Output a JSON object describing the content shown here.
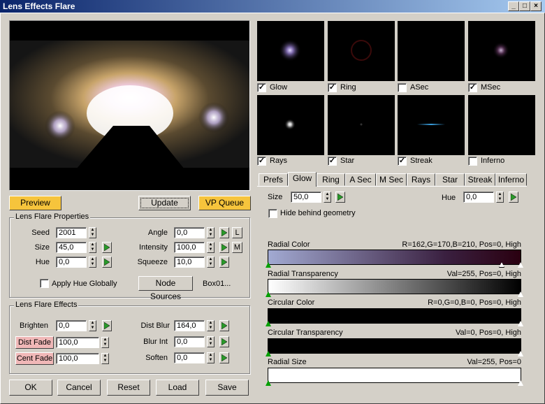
{
  "window": {
    "title": "Lens Effects Flare"
  },
  "buttons": {
    "preview": "Preview",
    "update": "Update",
    "vp_queue": "VP Queue",
    "node_sources": "Node Sources",
    "ok": "OK",
    "cancel": "Cancel",
    "reset": "Reset",
    "load": "Load",
    "save": "Save",
    "l": "L",
    "m": "M"
  },
  "properties": {
    "title": "Lens Flare Properties",
    "seed_label": "Seed",
    "seed": "2001",
    "size_label": "Size",
    "size": "45,0",
    "hue_label": "Hue",
    "hue": "0,0",
    "angle_label": "Angle",
    "angle": "0,0",
    "intensity_label": "Intensity",
    "intensity": "100,0",
    "squeeze_label": "Squeeze",
    "squeeze": "10,0",
    "apply_hue": "Apply Hue Globally",
    "node_name": "Box01..."
  },
  "effects": {
    "title": "Lens Flare Effects",
    "brighten_label": "Brighten",
    "brighten": "0,0",
    "dist_fade_label": "Dist Fade",
    "dist_fade": "100,0",
    "cent_fade_label": "Cent Fade",
    "cent_fade": "100,0",
    "dist_blur_label": "Dist Blur",
    "dist_blur": "164,0",
    "blur_int_label": "Blur Int",
    "blur_int": "0,0",
    "soften_label": "Soften",
    "soften": "0,0"
  },
  "thumbnails": [
    {
      "label": "Glow",
      "checked": true
    },
    {
      "label": "Ring",
      "checked": true
    },
    {
      "label": "ASec",
      "checked": false
    },
    {
      "label": "MSec",
      "checked": true
    },
    {
      "label": "Rays",
      "checked": true
    },
    {
      "label": "Star",
      "checked": true
    },
    {
      "label": "Streak",
      "checked": true
    },
    {
      "label": "Inferno",
      "checked": false
    }
  ],
  "tabs": [
    "Prefs",
    "Glow",
    "Ring",
    "A Sec",
    "M Sec",
    "Rays",
    "Star",
    "Streak",
    "Inferno"
  ],
  "active_tab": "Glow",
  "glow": {
    "size_label": "Size",
    "size": "50,0",
    "hue_label": "Hue",
    "hue": "0,0",
    "hide_behind": "Hide behind geometry",
    "radial_color_label": "Radial Color",
    "radial_color_value": "R=162,G=170,B=210, Pos=0, High",
    "radial_transparency_label": "Radial Transparency",
    "radial_transparency_value": "Val=255, Pos=0, High",
    "circular_color_label": "Circular Color",
    "circular_color_value": "R=0,G=0,B=0, Pos=0, High",
    "circular_transparency_label": "Circular Transparency",
    "circular_transparency_value": "Val=0, Pos=0, High",
    "radial_size_label": "Radial Size",
    "radial_size_value": "Val=255, Pos=0"
  },
  "colors": {
    "preview_button": "#f6c43c",
    "fade_highlight": "#f0b7b7",
    "marker": "#00a000"
  }
}
